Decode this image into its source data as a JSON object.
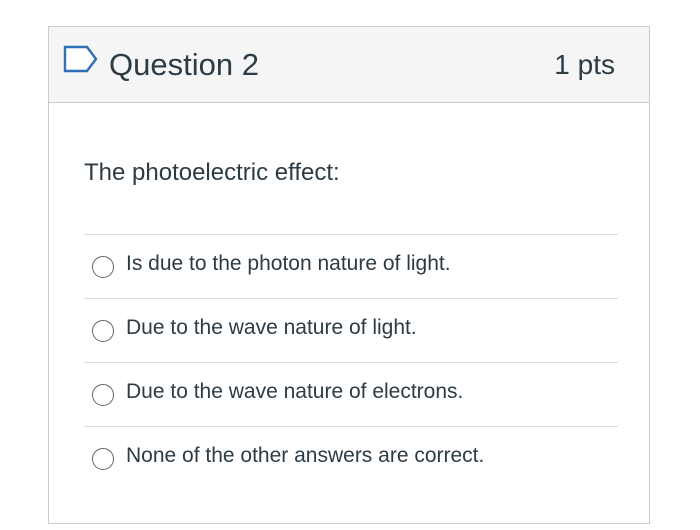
{
  "question": {
    "title": "Question 2",
    "points": "1 pts",
    "prompt": "The photoelectric effect:",
    "flag_icon": "bookmark-flag-icon",
    "accent_color": "#2d3b45",
    "answers": [
      {
        "label": "Is due to the photon nature of light.",
        "selected": false
      },
      {
        "label": "Due to the wave nature of light.",
        "selected": false
      },
      {
        "label": "Due to the wave nature of electrons.",
        "selected": false
      },
      {
        "label": "None of the other answers are correct.",
        "selected": false
      }
    ]
  }
}
